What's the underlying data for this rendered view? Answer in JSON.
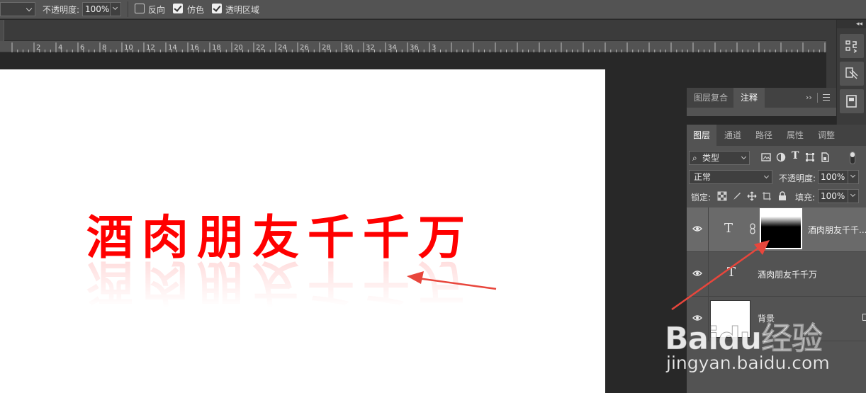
{
  "options_bar": {
    "opacity_label": "不透明度:",
    "opacity_value": "100%",
    "reverse_label": "反向",
    "reverse_checked": false,
    "dither_label": "仿色",
    "dither_checked": true,
    "transparency_label": "透明区域",
    "transparency_checked": true
  },
  "ruler": {
    "ticks": [
      "2",
      "4",
      "6",
      "8",
      "10",
      "12",
      "14",
      "16",
      "18",
      "20",
      "22",
      "24",
      "26",
      "28",
      "30",
      "32",
      "34",
      "36",
      "3"
    ]
  },
  "canvas": {
    "text": "酒肉朋友千千万",
    "text_color": "#ff0000"
  },
  "panels": {
    "top_tabs": [
      "图层复合",
      "注释"
    ],
    "top_active": "注释",
    "layers_tabs": [
      "图层",
      "通道",
      "路径",
      "属性",
      "调整"
    ],
    "layers_active": "图层",
    "filter_label": "类型",
    "blend_mode": "正常",
    "opacity_label": "不透明度:",
    "opacity_value": "100%",
    "lock_label": "锁定:",
    "fill_label": "填充:",
    "fill_value": "100%"
  },
  "layers": [
    {
      "name": "酒肉朋友千千...",
      "type": "text-with-mask",
      "selected": true
    },
    {
      "name": "酒肉朋友千千万",
      "type": "text",
      "selected": false
    },
    {
      "name": "背景",
      "type": "background",
      "selected": false
    }
  ],
  "watermark": {
    "logo": "Baidu经验",
    "url": "jingyan.baidu.com"
  },
  "colors": {
    "panel_bg": "#535353",
    "annotation_arrow": "#e8463c"
  }
}
